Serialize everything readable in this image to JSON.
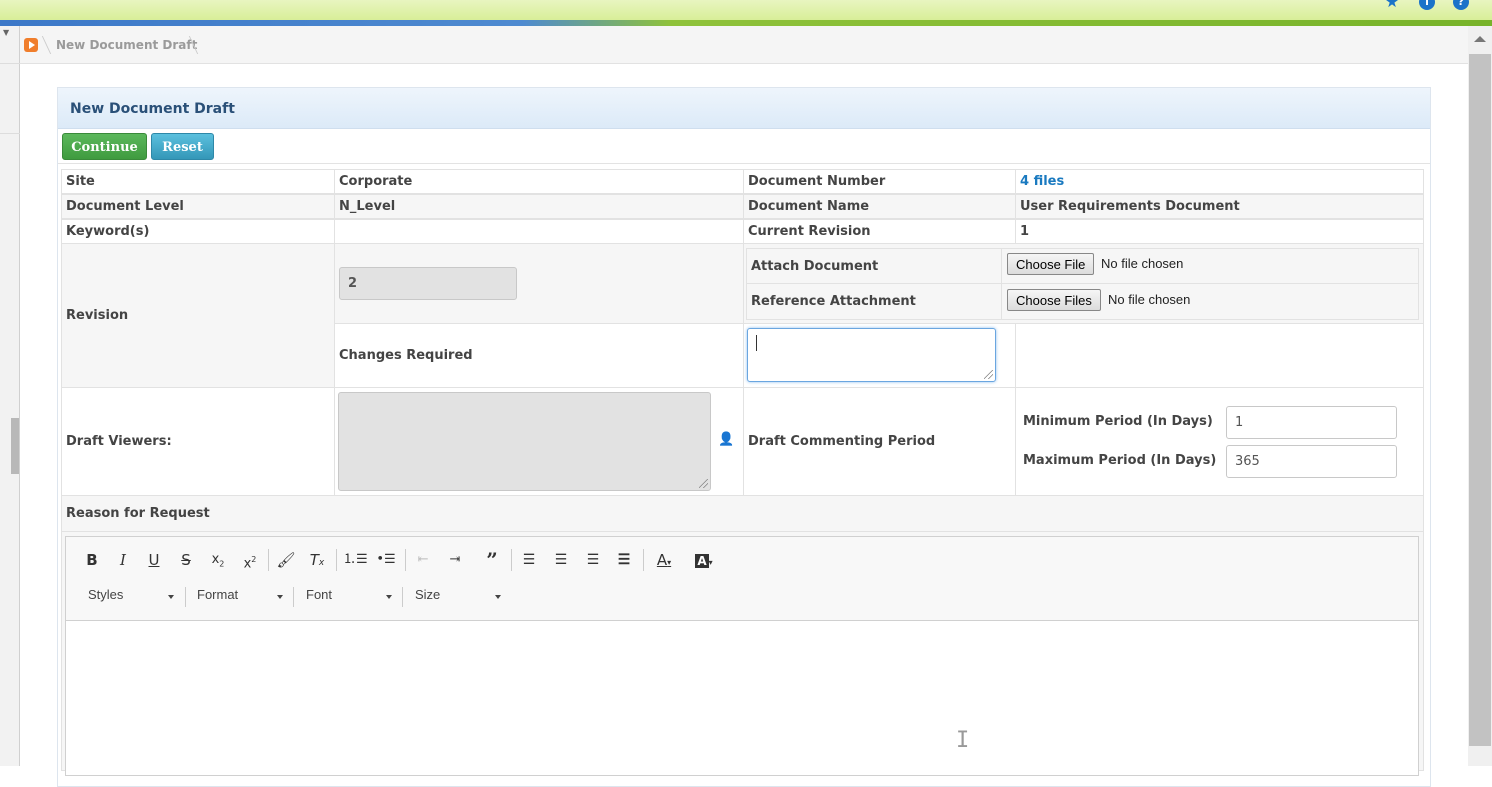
{
  "header": {
    "icons": [
      "star-icon",
      "info-icon",
      "help-icon"
    ]
  },
  "breadcrumb": {
    "title": "New Document Draft"
  },
  "panel": {
    "title": "New Document Draft",
    "continue_label": "Continue",
    "reset_label": "Reset"
  },
  "form": {
    "site_label": "Site",
    "site_value": "Corporate",
    "doc_number_label": "Document Number",
    "doc_number_value": "4 files",
    "doc_level_label": "Document Level",
    "doc_level_value": "N_Level",
    "doc_name_label": "Document Name",
    "doc_name_value": "User Requirements Document",
    "keywords_label": "Keyword(s)",
    "current_revision_label": "Current Revision",
    "current_revision_value": "1",
    "revision_label": "Revision",
    "revision_value": "2",
    "attach_document_label": "Attach Document",
    "attach_button": "Choose File",
    "attach_status": "No file chosen",
    "reference_attachment_label": "Reference Attachment",
    "reference_button": "Choose Files",
    "reference_status": "No file chosen",
    "changes_required_label": "Changes Required",
    "draft_viewers_label": "Draft Viewers:",
    "draft_commenting_label": "Draft Commenting Period",
    "min_period_label": "Minimum Period (In Days)",
    "min_period_value": "1",
    "max_period_label": "Maximum Period (In Days)",
    "max_period_value": "365",
    "reason_label": "Reason for Request"
  },
  "editor": {
    "styles": "Styles",
    "format": "Format",
    "font": "Font",
    "size": "Size"
  },
  "colors": {
    "accent": "#1a7ac0",
    "continue": "#4cae4c",
    "reset": "#46b8da"
  }
}
